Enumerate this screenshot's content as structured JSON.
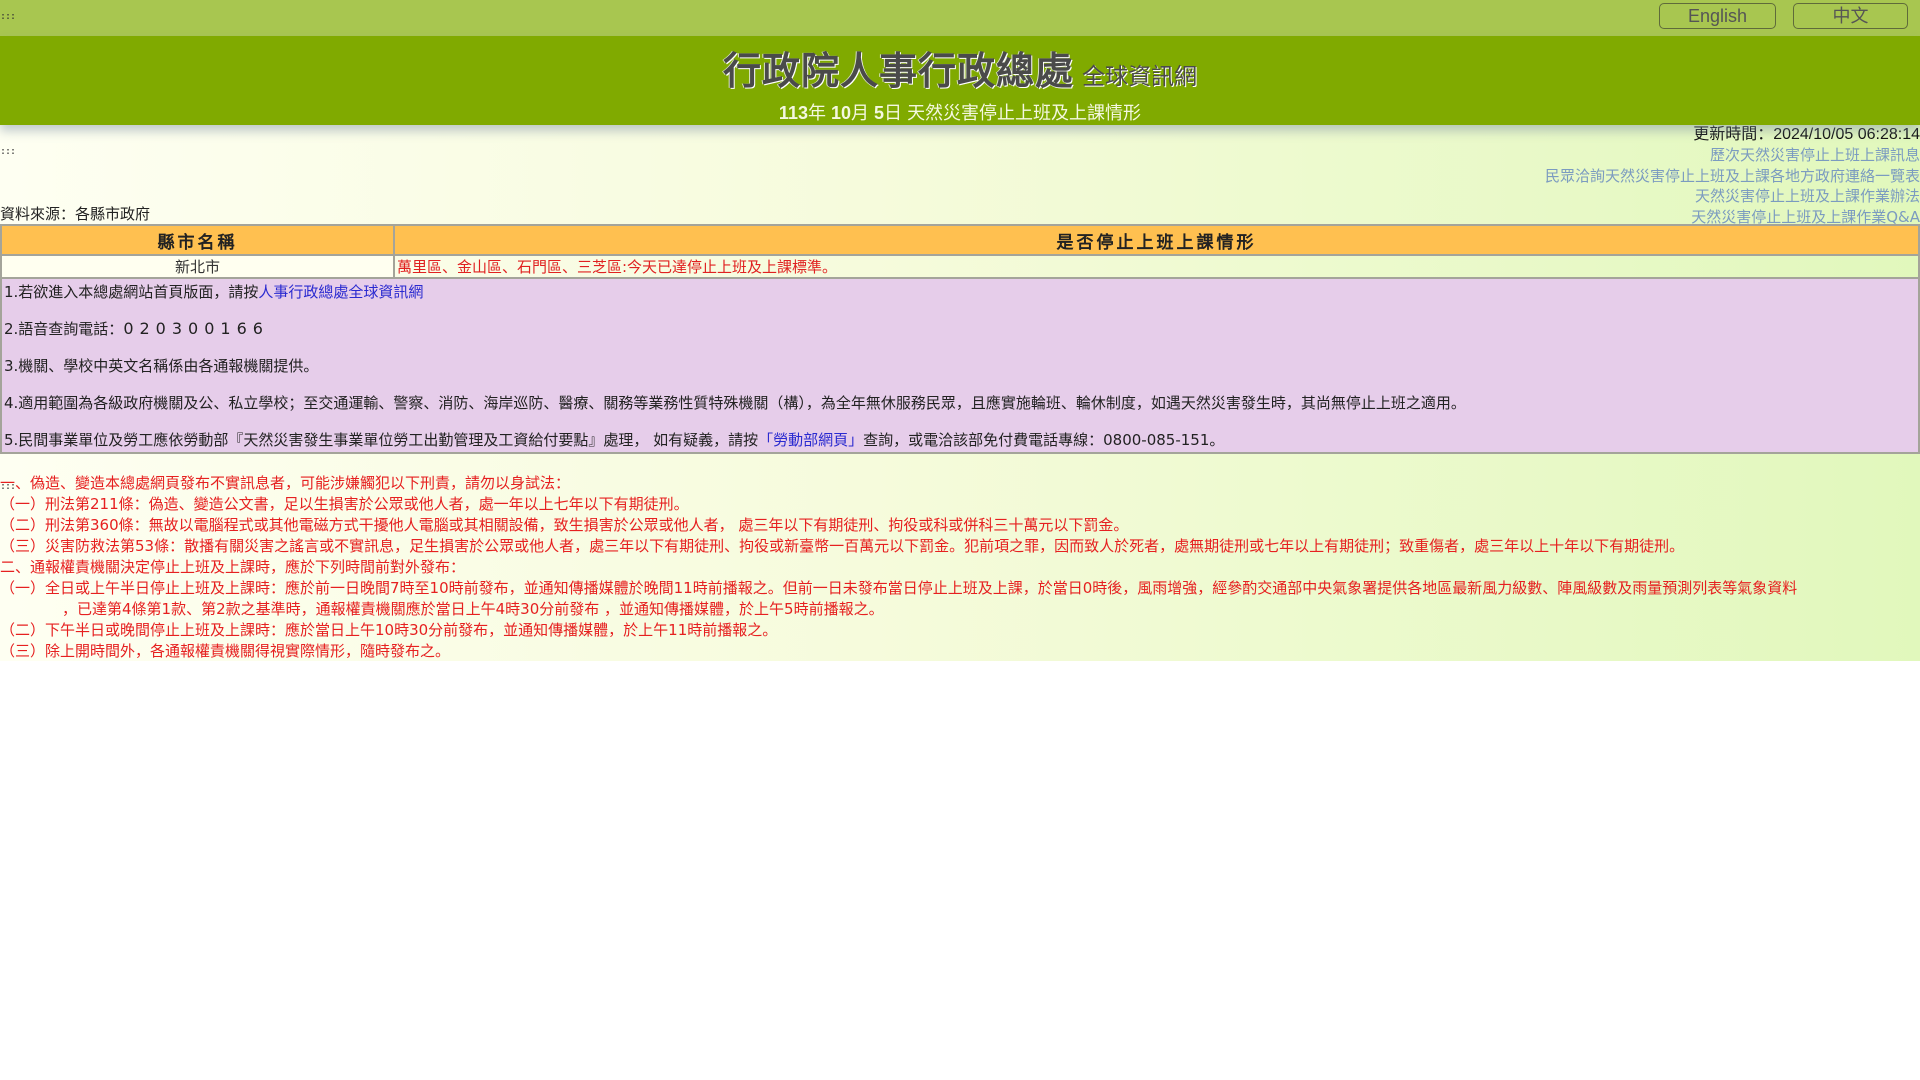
{
  "topbar": {
    "accesskey": ":::",
    "english_label": "English",
    "chinese_label": "中文"
  },
  "header": {
    "title": "行政院人事行政總處",
    "subtitle": "全球資訊網",
    "date_year": "113",
    "date_year_unit": "年",
    "date_month": "10",
    "date_month_unit": "月",
    "date_day": "5",
    "date_day_unit": "日",
    "date_caption": "天然災害停止上班及上課情形"
  },
  "content": {
    "accesskey": ":::",
    "update_time": "更新時間：2024/10/05 06:28:14",
    "links": [
      "歷次天然災害停止上班上課訊息",
      "民眾洽詢天然災害停止上班及上課各地方政府連絡一覽表",
      "天然災害停止上班及上課作業辦法",
      "天然災害停止上班及上課作業Q&A"
    ],
    "source": "資料來源：各縣市政府",
    "table": {
      "headers": [
        "縣市名稱",
        "是否停止上班上課情形"
      ],
      "rows": [
        {
          "city": "新北市",
          "status": "萬里區、金山區、石門區、三芝區:今天已達停止上班及上課標準。"
        }
      ]
    },
    "notes": {
      "n1_prefix": "1.若欲進入本總處網站首頁版面，請按",
      "n1_link": "人事行政總處全球資訊網",
      "n2_prefix": "2.語音查詢電話：",
      "n2_phone": "020300166",
      "n3": "3.機關、學校中英文名稱係由各通報機關提供。",
      "n4": "4.適用範圍為各級政府機關及公、私立學校；至交通運輸、警察、消防、海岸巡防、醫療、關務等業務性質特殊機關（構），為全年無休服務民眾，且應實施輪班、輪休制度，如遇天然災害發生時，其尚無停止上班之適用。",
      "n5_prefix": "5.民間事業單位及勞工應依勞動部『天然災害發生事業單位勞工出勤管理及工資給付要點』處理， 如有疑義，請按",
      "n5_link": "「勞動部網頁」",
      "n5_suffix": "查詢，或電洽該部免付費電話專線：0800-085-151。"
    },
    "warnings": {
      "w1_title": "一、偽造、變造本總處網頁發布不實訊息者，可能涉嫌觸犯以下刑責，請勿以身試法：",
      "w1_items": [
        "（一）刑法第211條：偽造、變造公文書，足以生損害於公眾或他人者，處一年以上七年以下有期徒刑。",
        "（二）刑法第360條：無故以電腦程式或其他電磁方式干擾他人電腦或其相關設備，致生損害於公眾或他人者， 處三年以下有期徒刑、拘役或科或併科三十萬元以下罰金。",
        "（三）災害防救法第53條：散播有關災害之謠言或不實訊息，足生損害於公眾或他人者，處三年以下有期徒刑、拘役或新臺幣一百萬元以下罰金。犯前項之罪，因而致人於死者，處無期徒刑或七年以上有期徒刑；致重傷者，處三年以上十年以下有期徒刑。"
      ],
      "w2_title": "二、通報權責機關決定停止上班及上課時，應於下列時間前對外發布：",
      "w2_item1_line1": "（一）全日或上午半日停止上班及上課時：應於前一日晚間7時至10時前發布，並通知傳播媒體於晚間11時前播報之。但前一日未發布當日停止上班及上課，於當日0時後，風雨增強，經參酌交通部中央氣象署提供各地區最新風力級數、陣風級數及雨量預測列表等氣象資料",
      "w2_item1_line2": "，已達第4條第1款、第2款之基準時，通報權責機關應於當日上午4時30分前發布 ，並通知傳播媒體，於上午5時前播報之。",
      "w2_item2": "（二）下午半日或晚間停止上班及上課時：應於當日上午10時30分前發布，並通知傳播媒體，於上午11時前播報之。",
      "w2_item3": "（三）除上開時間外，各通報權責機關得視實際情形，隨時發布之。"
    }
  },
  "colors": {
    "topbar": "#a8c650",
    "header": "#80aa00",
    "table_header": "#ffc050",
    "notes_bg": "#e6cdea",
    "alert_red": "#e62020",
    "link_blue": "#2a2ad0",
    "side_link": "#7b9bc0"
  }
}
